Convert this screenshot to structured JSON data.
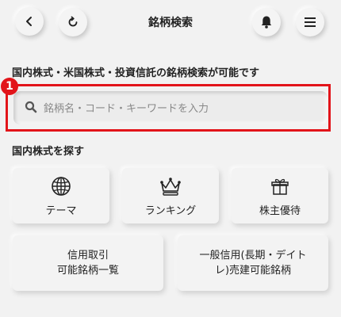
{
  "header": {
    "title": "銘柄検索",
    "back_icon": "chevron-left-icon",
    "reload_icon": "refresh-icon",
    "bell_icon": "bell-icon",
    "menu_icon": "hamburger-menu-icon"
  },
  "search_section": {
    "label": "国内株式・米国株式・投資信託の銘柄検索が可能です",
    "badge": "1",
    "placeholder": "銘柄名・コード・キーワードを入力",
    "value": "",
    "highlight_color": "#e2141a"
  },
  "domestic_section": {
    "label": "国内株式を探す",
    "tiles": [
      {
        "label": "テーマ",
        "icon": "globe-icon"
      },
      {
        "label": "ランキング",
        "icon": "crown-icon"
      },
      {
        "label": "株主優待",
        "icon": "gift-icon"
      }
    ],
    "wide_tiles": [
      {
        "line1": "信用取引",
        "line2": "可能銘柄一覧"
      },
      {
        "line1": "一般信用(長期・デイト",
        "line2": "レ)売建可能銘柄"
      }
    ]
  }
}
